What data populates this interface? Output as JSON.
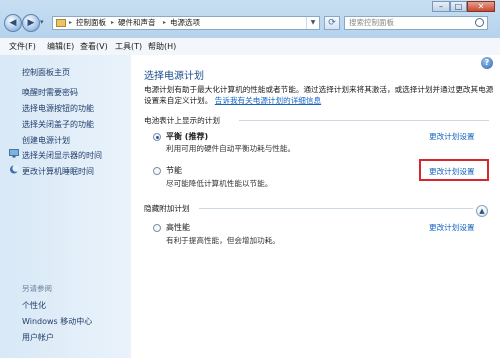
{
  "address": {
    "crumbs": [
      "控制面板",
      "硬件和声音",
      "电源选项"
    ]
  },
  "search": {
    "placeholder": "搜索控制面板"
  },
  "window": {
    "min": "–",
    "max": "□",
    "close": "✕"
  },
  "menubar": {
    "items": [
      "文件(F)",
      "编辑(E)",
      "查看(V)",
      "工具(T)",
      "帮助(H)"
    ]
  },
  "sidebar": {
    "home": "控制面板主页",
    "links": [
      "唤醒时需要密码",
      "选择电源按钮的功能",
      "选择关闭盖子的功能",
      "创建电源计划",
      "选择关闭显示器的时间",
      "更改计算机睡眠时间"
    ],
    "see_also_title": "另请参阅",
    "see_also": [
      "个性化",
      "Windows 移动中心",
      "用户帐户"
    ]
  },
  "main": {
    "title": "选择电源计划",
    "description": "电源计划有助于最大化计算机的性能或者节能。通过选择计划来将其激活，或选择计划并通过更改其电源设置来自定义计划。",
    "description_link": "告诉我有关电源计划的详细信息",
    "battery_group": "电池表计上显示的计划",
    "hidden_group": "隐藏附加计划",
    "plans": [
      {
        "name": "平衡 (推荐)",
        "desc": "利用可用的硬件自动平衡功耗与性能。",
        "change": "更改计划设置",
        "selected": true
      },
      {
        "name": "节能",
        "desc": "尽可能降低计算机性能以节能。",
        "change": "更改计划设置",
        "selected": false
      },
      {
        "name": "高性能",
        "desc": "有利于提高性能，但会增加功耗。",
        "change": "更改计划设置",
        "selected": false
      }
    ]
  },
  "colors": {
    "link": "#1565c0",
    "title": "#1c4d8c",
    "highlight": "#d8262a"
  }
}
